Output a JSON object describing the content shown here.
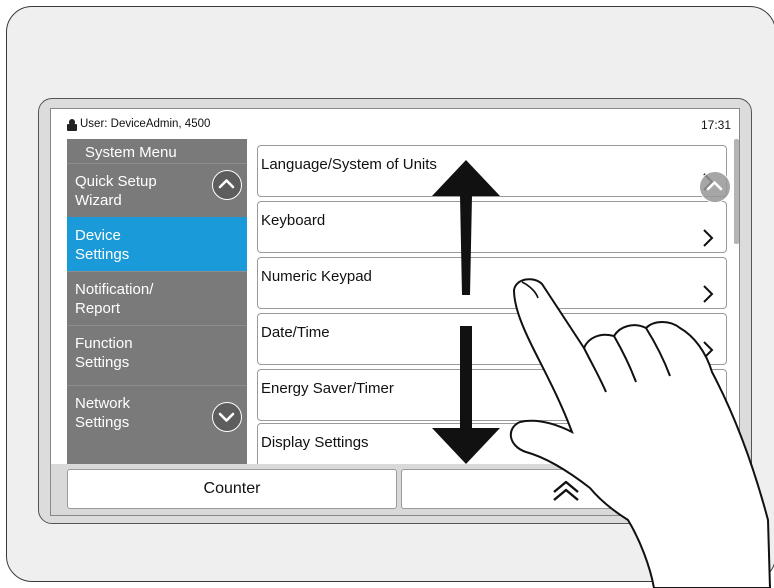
{
  "status_bar": {
    "user": "User: DeviceAdmin, 4500",
    "time": "17:31"
  },
  "sidebar": {
    "title": "System Menu",
    "items": [
      {
        "line1": "Quick Setup",
        "line2": "Wizard",
        "selected": false
      },
      {
        "line1": "Device",
        "line2": "Settings",
        "selected": true
      },
      {
        "line1": "Notification/",
        "line2": "Report",
        "selected": false
      },
      {
        "line1": "Function",
        "line2": "Settings",
        "selected": false
      },
      {
        "line1": "Network",
        "line2": "Settings",
        "selected": false
      }
    ],
    "scroll_up_icon": "chevron-up-icon",
    "scroll_down_icon": "chevron-down-icon"
  },
  "list": {
    "items": [
      {
        "label": "Language/System of Units"
      },
      {
        "label": "Keyboard"
      },
      {
        "label": "Numeric Keypad"
      },
      {
        "label": "Date/Time"
      },
      {
        "label": "Energy Saver/Timer"
      },
      {
        "label": "Display Settings"
      }
    ],
    "item_icon": "chevron-right-icon"
  },
  "bottom_bar": {
    "counter_label": "Counter",
    "home_icon": "double-chevron-up-icon"
  },
  "overlay": {
    "gesture": "swipe-up-down",
    "arrow_color": "#111111"
  }
}
